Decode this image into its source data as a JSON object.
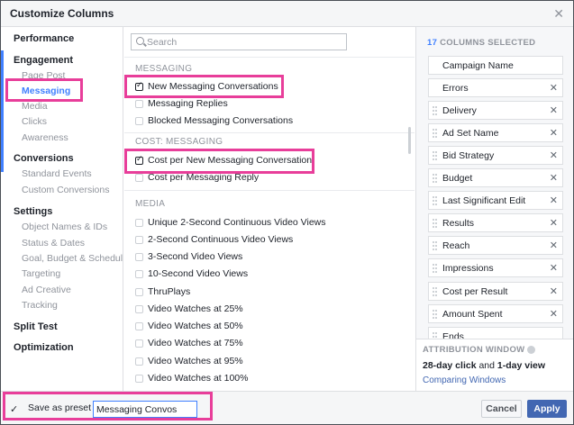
{
  "window": {
    "title": "Customize Columns",
    "close_glyph": "✕"
  },
  "nav": {
    "performance": "Performance",
    "engagement": "Engagement",
    "page_post": "Page Post",
    "messaging": "Messaging",
    "media": "Media",
    "clicks": "Clicks",
    "awareness": "Awareness",
    "conversions": "Conversions",
    "standard_events": "Standard Events",
    "custom_conversions": "Custom Conversions",
    "settings": "Settings",
    "object_names": "Object Names & IDs",
    "status_dates": "Status & Dates",
    "goal_budget": "Goal, Budget & Schedule",
    "targeting": "Targeting",
    "ad_creative": "Ad Creative",
    "tracking": "Tracking",
    "split_test": "Split Test",
    "optimization": "Optimization"
  },
  "search": {
    "placeholder": "Search"
  },
  "list": {
    "messaging_header": "MESSAGING",
    "new_messaging_conversations": "New Messaging Conversations",
    "messaging_replies": "Messaging Replies",
    "blocked_messaging_conversations": "Blocked Messaging Conversations",
    "cost_messaging_header": "COST: MESSAGING",
    "cost_per_new_messaging_conversation": "Cost per New Messaging Conversation",
    "cost_per_messaging_reply": "Cost per Messaging Reply",
    "media_header": "MEDIA",
    "unique_2s_video": "Unique 2-Second Continuous Video Views",
    "two_s_video": "2-Second Continuous Video Views",
    "three_s_video": "3-Second Video Views",
    "ten_s_video": "10-Second Video Views",
    "thruplays": "ThruPlays",
    "vw25": "Video Watches at 25%",
    "vw50": "Video Watches at 50%",
    "vw75": "Video Watches at 75%",
    "vw95": "Video Watches at 95%",
    "vw100": "Video Watches at 100%"
  },
  "selected": {
    "count": "17",
    "header_text": "COLUMNS SELECTED",
    "remove_glyph": "✕",
    "columns": {
      "c0": "Campaign Name",
      "c1": "Errors",
      "c2": "Delivery",
      "c3": "Ad Set Name",
      "c4": "Bid Strategy",
      "c5": "Budget",
      "c6": "Last Significant Edit",
      "c7": "Results",
      "c8": "Reach",
      "c9": "Impressions",
      "c10": "Cost per Result",
      "c11": "Amount Spent",
      "c12": "Ends"
    }
  },
  "attribution": {
    "header": "ATTRIBUTION WINDOW",
    "click": "28-day click",
    "and": " and ",
    "view": "1-day view",
    "link": "Comparing Windows"
  },
  "footer": {
    "preset_check": "✓",
    "preset_label": "Save as preset",
    "preset_value": "Messaging Convos",
    "cancel": "Cancel",
    "apply": "Apply"
  },
  "colors": {
    "accent": "#4080ff",
    "primary_button": "#4267b2",
    "highlight": "#e83e9a"
  }
}
